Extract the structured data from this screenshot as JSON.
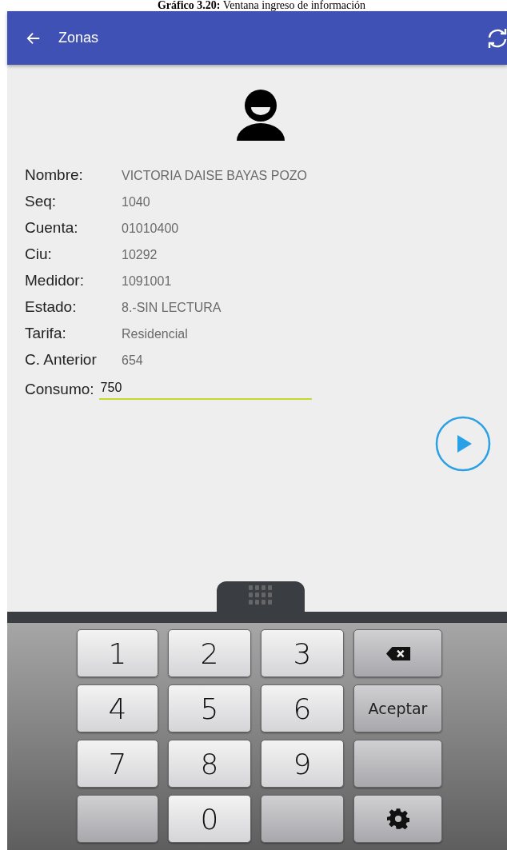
{
  "caption": "**Gráfico 3.20:** Ventana ingreso de información",
  "app_bar": {
    "title": "Zonas"
  },
  "fields": [
    {
      "label": "Nombre:",
      "value": "VICTORIA DAISE BAYAS POZO"
    },
    {
      "label": "Seq:",
      "value": "1040"
    },
    {
      "label": "Cuenta:",
      "value": "01010400"
    },
    {
      "label": "Ciu:",
      "value": "10292"
    },
    {
      "label": "Medidor:",
      "value": "1091001"
    },
    {
      "label": "Estado:",
      "value": "8.-SIN LECTURA"
    },
    {
      "label": "Tarifa:",
      "value": "Residencial"
    },
    {
      "label": "C. Anterior",
      "value": "654"
    }
  ],
  "input": {
    "label": "Consumo:",
    "value": "750"
  },
  "keys": [
    {
      "kind": "digit",
      "label": "1"
    },
    {
      "kind": "digit",
      "label": "2"
    },
    {
      "kind": "digit",
      "label": "3"
    },
    {
      "kind": "backspace"
    },
    {
      "kind": "digit",
      "label": "4"
    },
    {
      "kind": "digit",
      "label": "5"
    },
    {
      "kind": "digit",
      "label": "6"
    },
    {
      "kind": "text",
      "label": "Aceptar"
    },
    {
      "kind": "digit",
      "label": "7"
    },
    {
      "kind": "digit",
      "label": "8"
    },
    {
      "kind": "digit",
      "label": "9"
    },
    {
      "kind": "blank"
    },
    {
      "kind": "blank"
    },
    {
      "kind": "digit",
      "label": "0"
    },
    {
      "kind": "blank"
    },
    {
      "kind": "settings"
    }
  ]
}
